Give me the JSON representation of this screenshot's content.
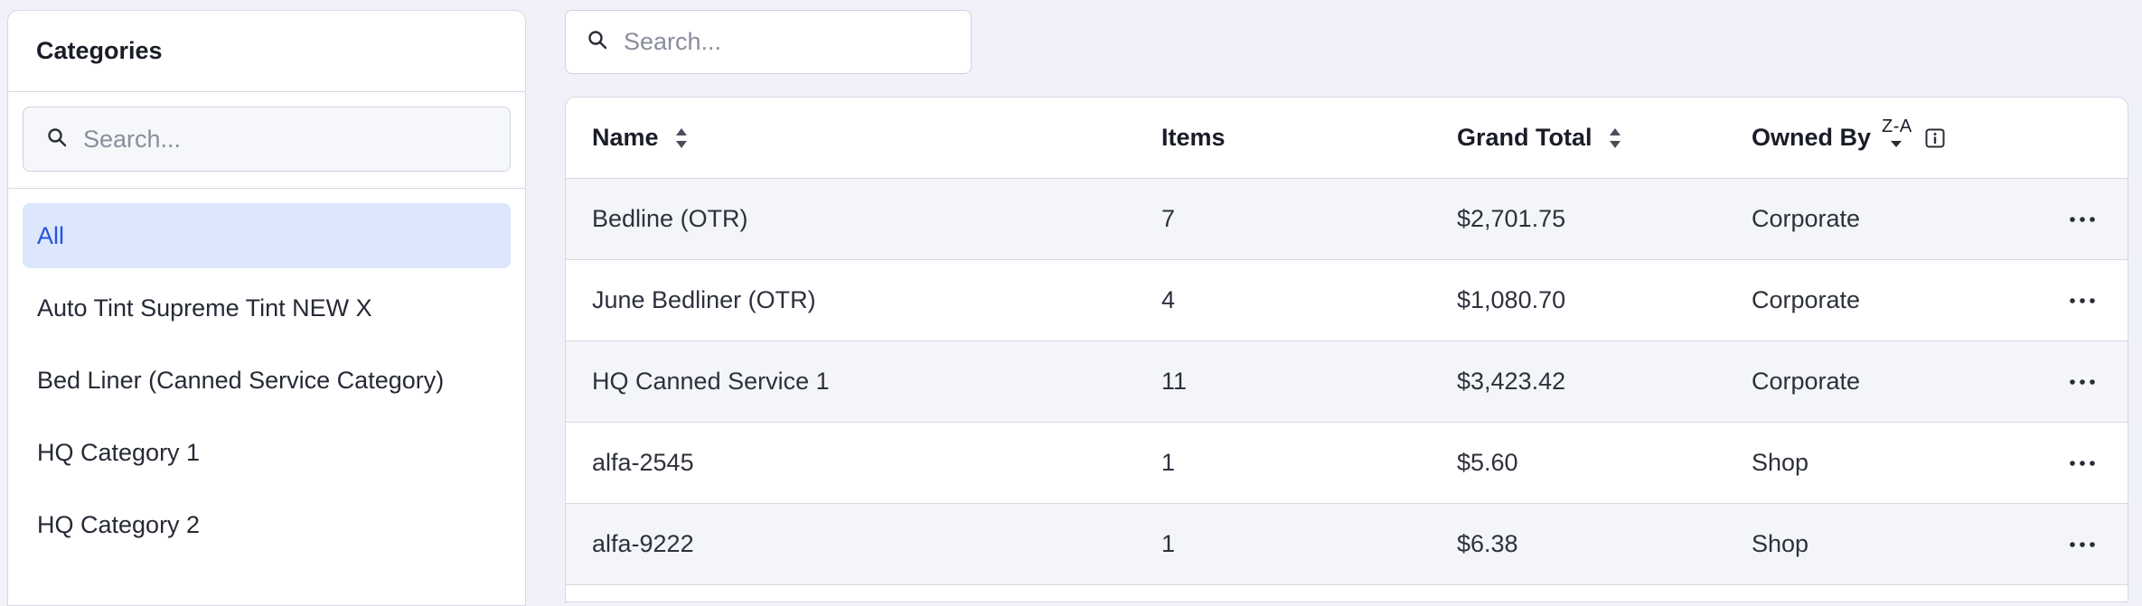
{
  "sidebar": {
    "title": "Categories",
    "search_placeholder": "Search...",
    "items": [
      {
        "label": "All",
        "active": true
      },
      {
        "label": "Auto Tint Supreme Tint NEW X"
      },
      {
        "label": "Bed Liner (Canned Service Category)"
      },
      {
        "label": "HQ Category 1"
      },
      {
        "label": "HQ Category 2"
      }
    ]
  },
  "main": {
    "search_placeholder": "Search...",
    "table": {
      "headers": {
        "name": "Name",
        "items": "Items",
        "grand_total": "Grand Total",
        "owned_by": "Owned By",
        "owned_by_sort": "Z-A"
      },
      "rows": [
        {
          "name": "Bedline (OTR)",
          "items": "7",
          "grand_total": "$2,701.75",
          "owned_by": "Corporate"
        },
        {
          "name": "June Bedliner (OTR)",
          "items": "4",
          "grand_total": "$1,080.70",
          "owned_by": "Corporate"
        },
        {
          "name": "HQ Canned Service 1",
          "items": "11",
          "grand_total": "$3,423.42",
          "owned_by": "Corporate"
        },
        {
          "name": "alfa-2545",
          "items": "1",
          "grand_total": "$5.60",
          "owned_by": "Shop"
        },
        {
          "name": "alfa-9222",
          "items": "1",
          "grand_total": "$6.38",
          "owned_by": "Shop"
        }
      ]
    }
  },
  "icons": {
    "search": "search-icon",
    "sort": "sort-icon",
    "sort_desc": "sort-desc-icon",
    "info": "info-icon",
    "more": "more-horizontal-icon"
  },
  "colors": {
    "background": "#f0f1f9",
    "active_bg": "#dce6fd",
    "active_text": "#2256e0",
    "border": "#d6d8e3"
  }
}
